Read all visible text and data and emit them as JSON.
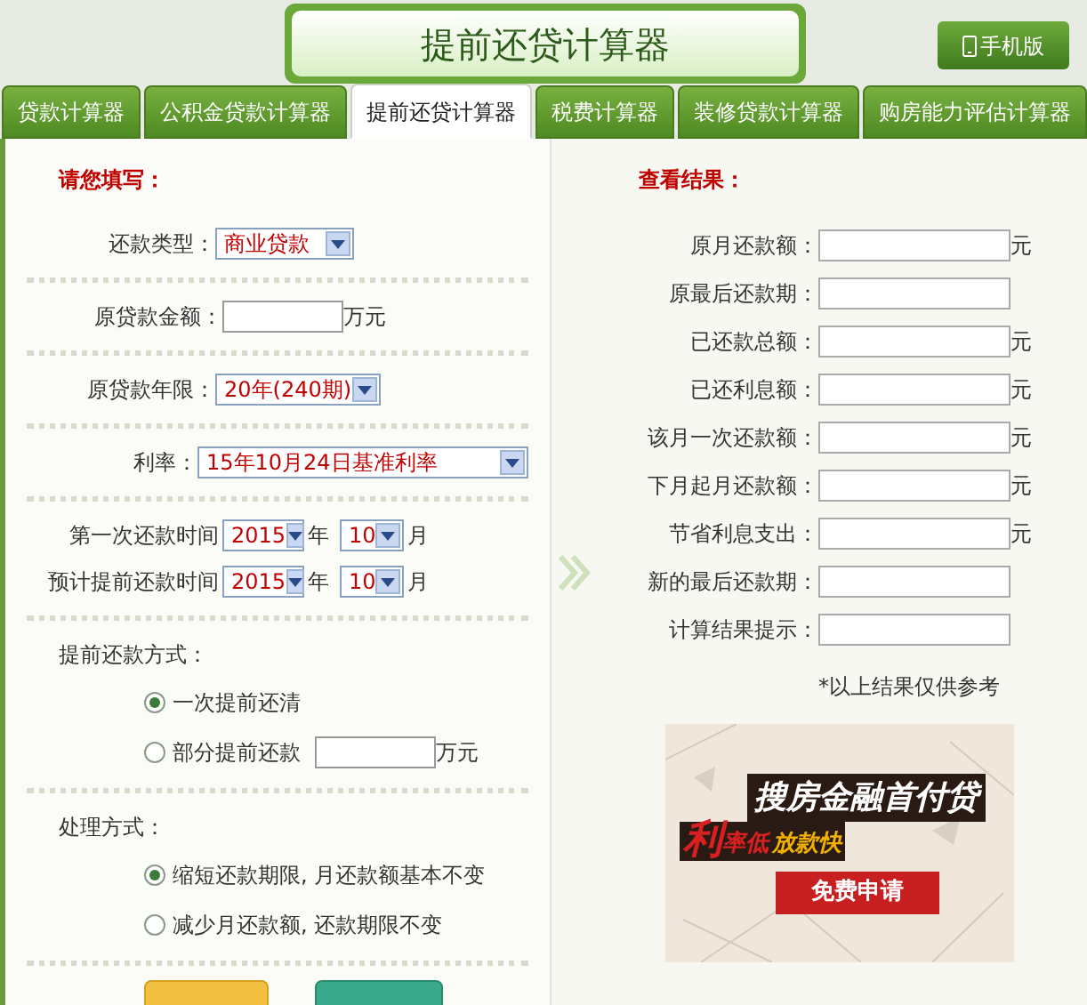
{
  "header": {
    "title": "提前还贷计算器",
    "mobile_button": "手机版"
  },
  "tabs": [
    {
      "label": "贷款计算器",
      "selected": false
    },
    {
      "label": "公积金贷款计算器",
      "selected": false
    },
    {
      "label": "提前还贷计算器",
      "selected": true
    },
    {
      "label": "税费计算器",
      "selected": false
    },
    {
      "label": "装修贷款计算器",
      "selected": false
    },
    {
      "label": "购房能力评估计算器",
      "selected": false
    }
  ],
  "form": {
    "heading": "请您填写：",
    "groups": [
      [
        {
          "kind": "select",
          "label": "还款类型：",
          "value": "商业贷款"
        }
      ],
      [
        {
          "kind": "input",
          "label": "原贷款金额：",
          "unit": "万元"
        }
      ],
      [
        {
          "kind": "select",
          "label": "原贷款年限：",
          "value": "20年(240期)"
        }
      ],
      [
        {
          "kind": "long_select",
          "label": "利率：",
          "value": "15年10月24日基准利率"
        }
      ],
      [
        {
          "kind": "date",
          "label": "第一次还款时间",
          "year": "2015",
          "year_unit": "年",
          "month": "10",
          "month_unit": "月"
        },
        {
          "kind": "date",
          "label": "预计提前还款时间",
          "year": "2015",
          "year_unit": "年",
          "month": "10",
          "month_unit": "月"
        }
      ]
    ],
    "prepay_method": {
      "label": "提前还款方式：",
      "options": [
        {
          "label": "一次提前还清",
          "selected": true
        },
        {
          "label": "部分提前还款",
          "selected": false,
          "unit": "万元"
        }
      ]
    },
    "process_method": {
      "label": "处理方式：",
      "options": [
        {
          "label": "缩短还款期限, 月还款额基本不变",
          "selected": true
        },
        {
          "label": "减少月还款额, 还款期限不变",
          "selected": false
        }
      ]
    }
  },
  "results": {
    "heading": "查看结果：",
    "rows": [
      {
        "label": "原月还款额：",
        "unit": "元"
      },
      {
        "label": "原最后还款期："
      },
      {
        "label": "已还款总额：",
        "unit": "元"
      },
      {
        "label": "已还利息额：",
        "unit": "元"
      },
      {
        "label": "该月一次还款额：",
        "unit": "元"
      },
      {
        "label": "下月起月还款额：",
        "unit": "元"
      },
      {
        "label": "节省利息支出：",
        "unit": "元"
      },
      {
        "label": "新的最后还款期："
      },
      {
        "label": "计算结果提示："
      }
    ],
    "note": "*以上结果仅供参考",
    "ad": {
      "headline": "搜房金融首付贷",
      "big_char": "利",
      "tagline_1": "率低",
      "tagline_2": "放款快",
      "cta": "免费申请"
    }
  }
}
